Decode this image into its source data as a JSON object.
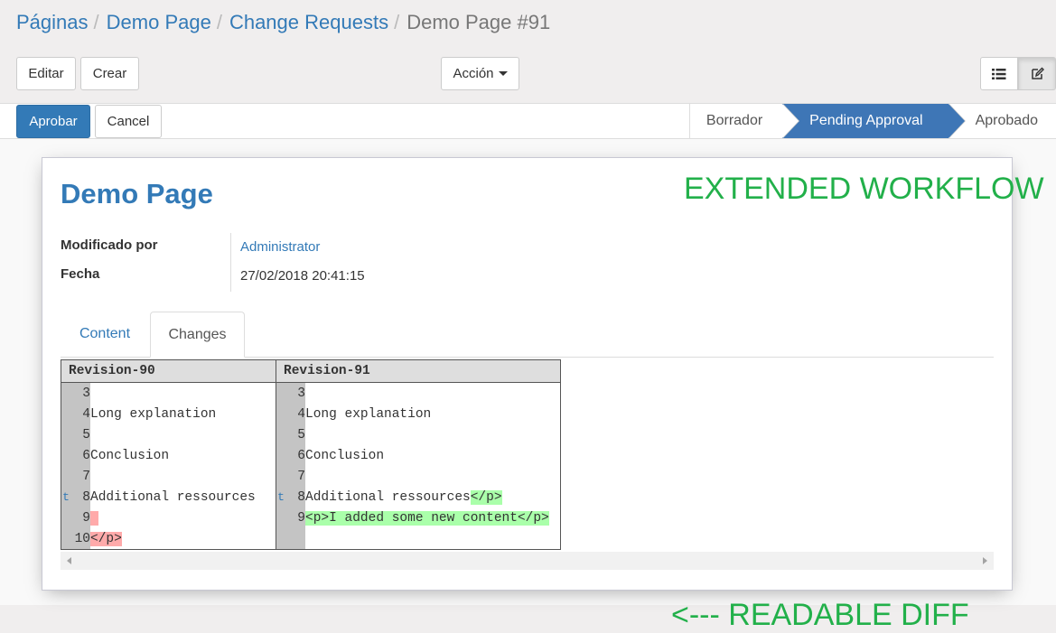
{
  "breadcrumb": {
    "items": [
      "Páginas",
      "Demo Page",
      "Change Requests"
    ],
    "sep": "/",
    "active": "Demo Page #91"
  },
  "toolbar": {
    "edit": "Editar",
    "create": "Crear",
    "action": "Acción"
  },
  "statusbar": {
    "approve": "Aprobar",
    "cancel": "Cancel",
    "stages": [
      "Borrador",
      "Pending Approval",
      "Aprobado"
    ],
    "active_stage": "Pending Approval"
  },
  "record": {
    "title": "Demo Page",
    "modified_by_label": "Modificado por",
    "modified_by": "Administrator",
    "date_label": "Fecha",
    "date": "27/02/2018 20:41:15"
  },
  "tabs": [
    "Content",
    "Changes"
  ],
  "active_tab": "Changes",
  "diff": {
    "left_header": "Revision-90",
    "right_header": "Revision-91",
    "rows": [
      {
        "lflag": "",
        "lnum": "3",
        "ltext": "",
        "rflag": "",
        "rnum": "3",
        "rtext": ""
      },
      {
        "lflag": "",
        "lnum": "4",
        "ltext": "Long explanation",
        "rflag": "",
        "rnum": "4",
        "rtext": "Long explanation"
      },
      {
        "lflag": "",
        "lnum": "5",
        "ltext": "",
        "rflag": "",
        "rnum": "5",
        "rtext": ""
      },
      {
        "lflag": "",
        "lnum": "6",
        "ltext": "Conclusion",
        "rflag": "",
        "rnum": "6",
        "rtext": "Conclusion"
      },
      {
        "lflag": "",
        "lnum": "7",
        "ltext": "",
        "rflag": "",
        "rnum": "7",
        "rtext": ""
      },
      {
        "lflag": "t",
        "lnum": "8",
        "ltext": "Additional ressources",
        "rflag": "t",
        "rnum": "8",
        "rtext": "Additional ressources",
        "rtext_add": "</p>"
      },
      {
        "lflag": "",
        "lnum": "9",
        "ltext": "",
        "ltext_del": " ",
        "rflag": "",
        "rnum": "9",
        "rtext": "",
        "rtext_add": "<p>I added some new content</p>"
      },
      {
        "lflag": "",
        "lnum": "10",
        "ltext": "",
        "ltext_del": "</p>",
        "rflag": "",
        "rnum": "",
        "rtext": ""
      }
    ]
  },
  "annotations": {
    "workflow": "EXTENDED WORKFLOW",
    "diff": "<--- READABLE DIFF"
  },
  "colors": {
    "primary": "#337ab7",
    "annotation": "#22b04a",
    "added": "#aaffaa",
    "deleted": "#ffaaaa",
    "stage_active": "#3e76b6"
  },
  "icons": {
    "list_view": "list-icon",
    "form_view": "edit-icon"
  }
}
